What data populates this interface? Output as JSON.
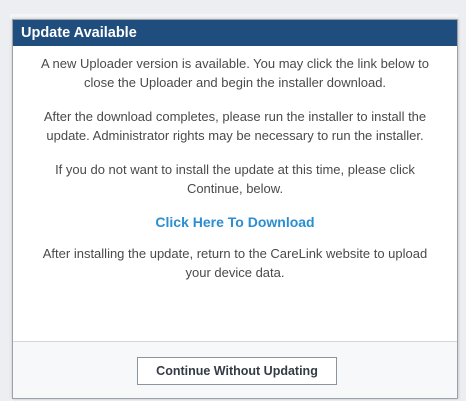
{
  "dialog": {
    "title": "Update Available",
    "paragraphs": [
      "A new Uploader version is available. You may click the link below to close the Uploader and begin the installer download.",
      "After the download completes, please run the installer to install the update. Administrator rights may be necessary to run the installer.",
      "If you do not want to install the update at this time, please click Continue, below."
    ],
    "download_link": "Click Here To Download",
    "after_install": "After installing the update, return to the CareLink website to upload your device data.",
    "continue_button": "Continue Without Updating"
  },
  "colors": {
    "header_bg": "#1f4d7d",
    "link": "#2a8ed1",
    "body_text": "#4a4a4a"
  }
}
